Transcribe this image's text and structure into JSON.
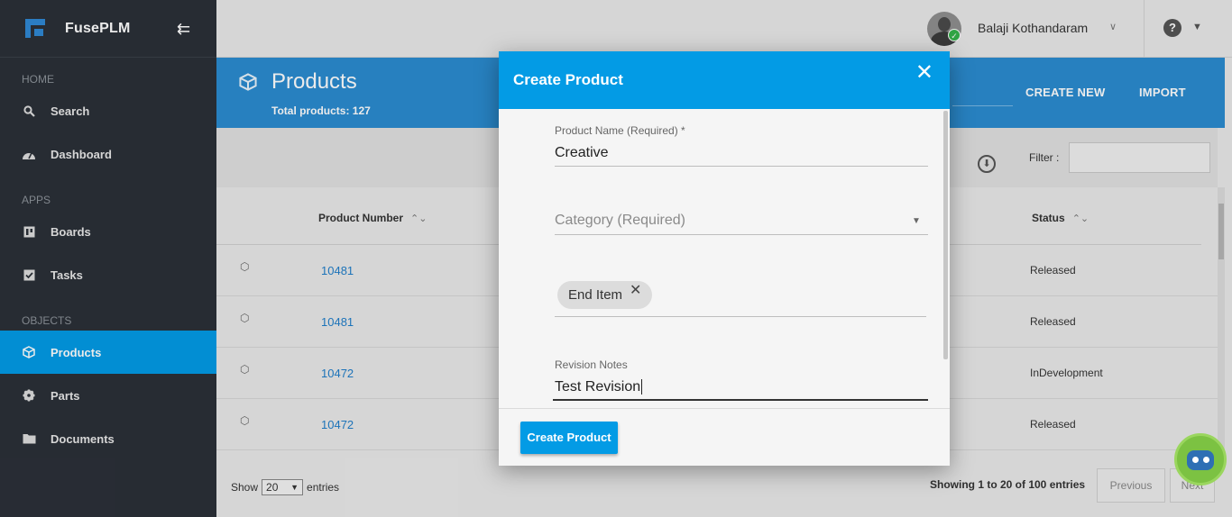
{
  "brand": {
    "name": "FusePLM"
  },
  "sidebar": {
    "sections": [
      "HOME",
      "APPS",
      "OBJECTS"
    ],
    "items": [
      {
        "label": "Search",
        "icon": "search-icon"
      },
      {
        "label": "Dashboard",
        "icon": "dashboard-icon"
      },
      {
        "label": "Boards",
        "icon": "board-icon"
      },
      {
        "label": "Tasks",
        "icon": "checkbox-icon"
      },
      {
        "label": "Products",
        "icon": "cube-icon",
        "active": true
      },
      {
        "label": "Parts",
        "icon": "gear-icon"
      },
      {
        "label": "Documents",
        "icon": "folder-icon"
      }
    ]
  },
  "topbar": {
    "user_name": "Balaji Kothandaram"
  },
  "page": {
    "title": "Products",
    "subtitle_label": "Total products:",
    "subtitle_count": "127",
    "create_new": "CREATE NEW",
    "import": "IMPORT"
  },
  "toolbar": {
    "filter_label": "Filter :"
  },
  "table": {
    "headers": {
      "product_number": "Product Number",
      "status": "Status"
    },
    "rows": [
      {
        "number": "10481",
        "status": "Released"
      },
      {
        "number": "10481",
        "status": "Released"
      },
      {
        "number": "10472",
        "status": "InDevelopment"
      },
      {
        "number": "10472",
        "status": "Released"
      }
    ]
  },
  "footer": {
    "show_label": "Show",
    "entries_value": "20",
    "entries_label": "entries",
    "showing": "Showing 1 to 20 of 100 entries",
    "previous": "Previous",
    "next": "Next"
  },
  "modal": {
    "title": "Create Product",
    "product_name_label": "Product Name (Required) *",
    "product_name_value": "Creative",
    "category_placeholder": "Category (Required)",
    "chip_label": "End Item",
    "revision_label": "Revision Notes",
    "revision_value": "Test Revision",
    "submit": "Create Product"
  },
  "colors": {
    "accent": "#039be5",
    "sidebar": "#2b3038",
    "header_band": "#2b8bd0",
    "link": "#1f7dc9"
  }
}
